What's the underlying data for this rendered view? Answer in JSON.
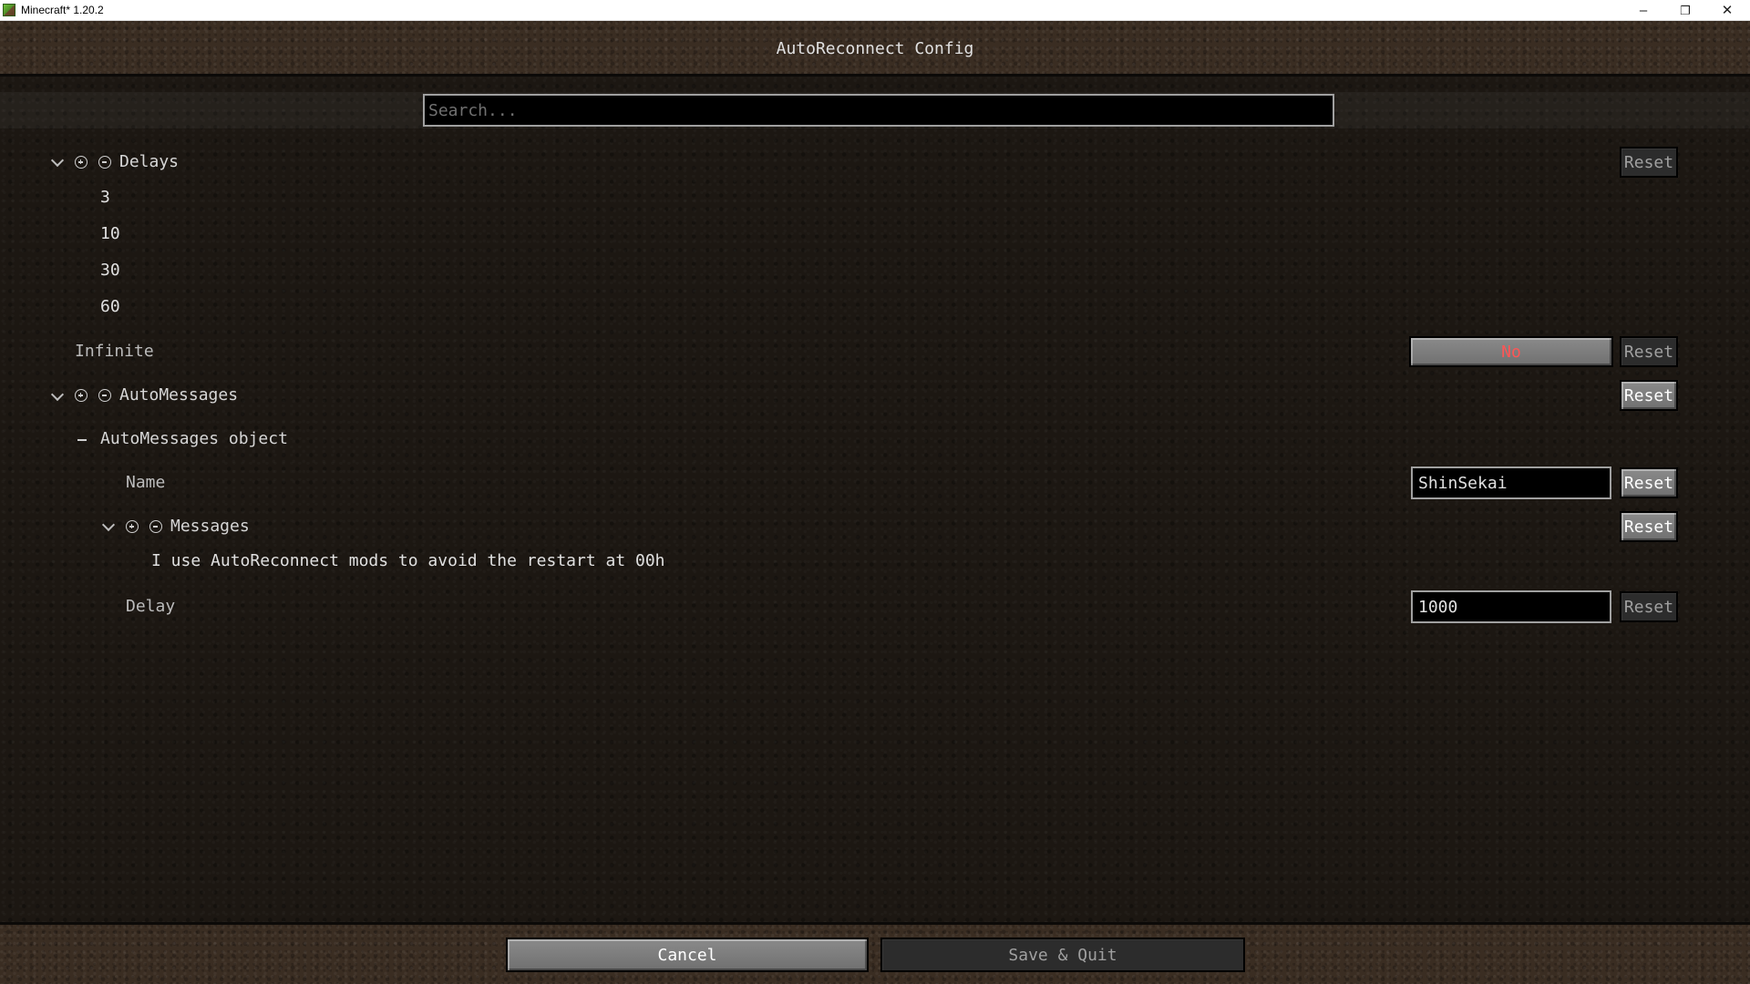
{
  "window": {
    "title": "Minecraft* 1.20.2",
    "minimize": "–",
    "restore": "❐",
    "close": "✕"
  },
  "screen": {
    "title": "AutoReconnect Config"
  },
  "search": {
    "placeholder": "Search..."
  },
  "delays": {
    "label": "Delays",
    "reset_label": "Reset",
    "items": [
      "3",
      "10",
      "30",
      "60"
    ]
  },
  "infinite": {
    "label": "Infinite",
    "value": "No",
    "reset_label": "Reset"
  },
  "auto_messages": {
    "label": "AutoMessages",
    "reset_label": "Reset",
    "object": {
      "label": "AutoMessages object",
      "name": {
        "label": "Name",
        "value": "ShinSekai",
        "reset_label": "Reset"
      },
      "messages": {
        "label": "Messages",
        "reset_label": "Reset",
        "items": [
          "I use AutoReconnect mods to avoid the restart at 00h"
        ]
      },
      "delay": {
        "label": "Delay",
        "value": "1000",
        "reset_label": "Reset"
      }
    }
  },
  "footer": {
    "cancel_label": "Cancel",
    "save_label": "Save & Quit"
  },
  "colors": {
    "toggle_false": "#ff5555",
    "dirt": "#3a2d22",
    "list_background": "#1c1712"
  }
}
